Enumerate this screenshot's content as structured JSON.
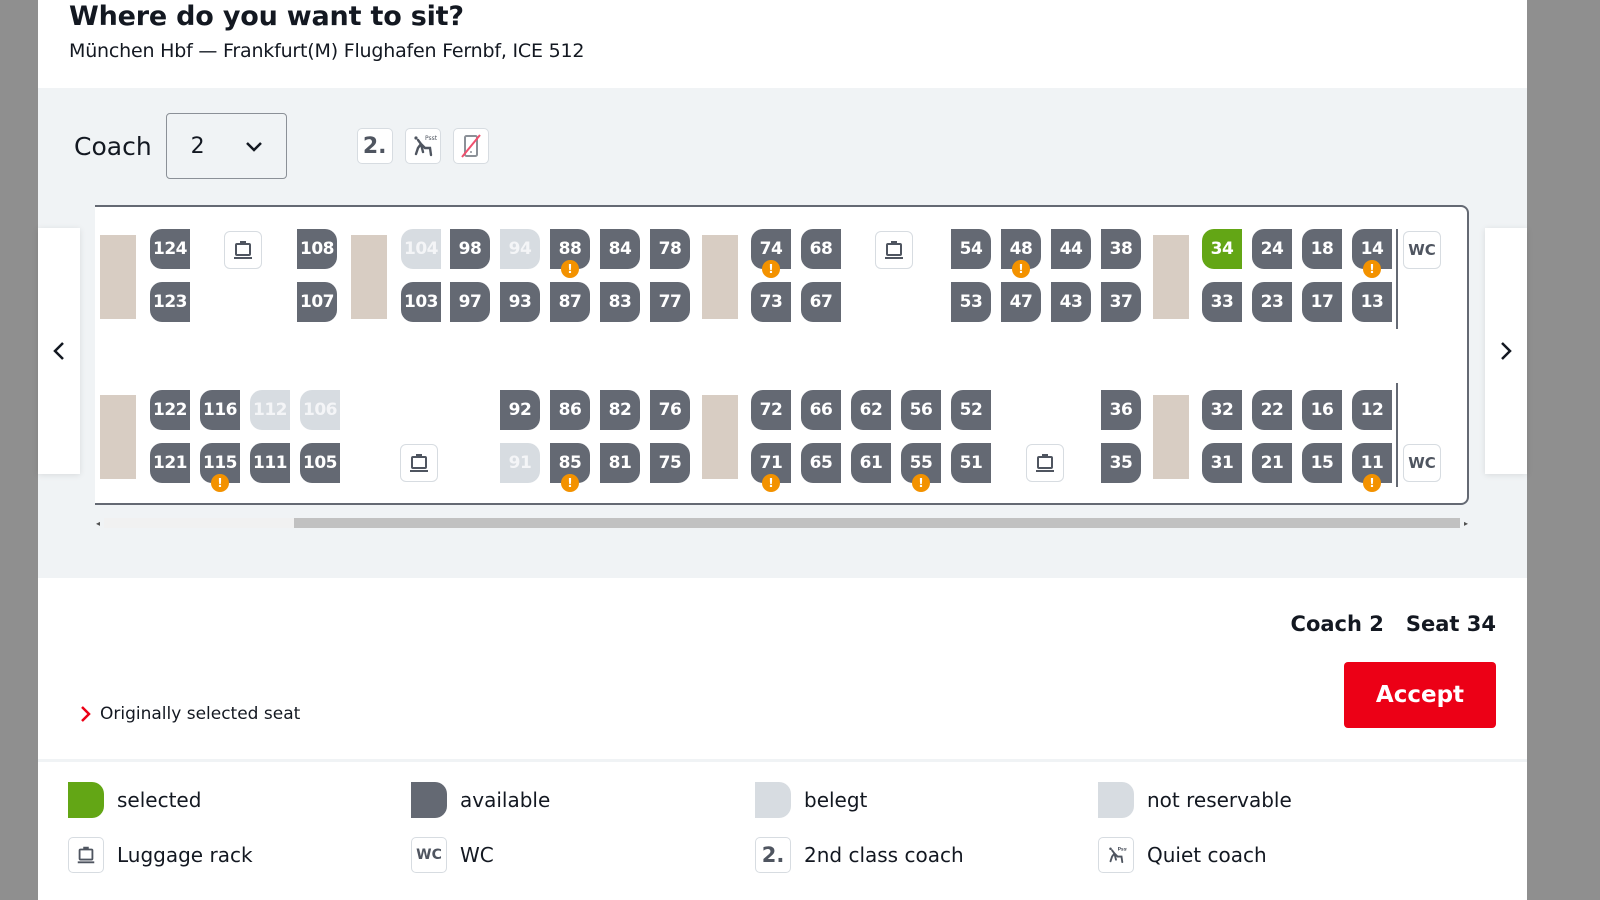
{
  "header": {
    "title": "Where do you want to sit?",
    "route": "München Hbf — Frankfurt(M) Flughafen Fernbf, ICE 512"
  },
  "coach_selector": {
    "label": "Coach",
    "selected": "2",
    "icons": [
      {
        "name": "second-class-icon",
        "text": "2."
      },
      {
        "name": "quiet-coach-icon",
        "text": ""
      },
      {
        "name": "no-phone-icon",
        "text": ""
      }
    ]
  },
  "colors": {
    "selected": "#63a615",
    "available": "#646973",
    "occupied": "#d7dce1",
    "table": "#d8cdc3",
    "warning": "#f39200",
    "accept": "#ec0016"
  },
  "seats": [
    {
      "n": "124",
      "state": "available",
      "face": "l",
      "warn": false
    },
    {
      "n": "123",
      "state": "available",
      "face": "l",
      "warn": false
    },
    {
      "n": "108",
      "state": "available",
      "face": "r",
      "warn": false
    },
    {
      "n": "107",
      "state": "available",
      "face": "r",
      "warn": false
    },
    {
      "n": "104",
      "state": "occupied",
      "face": "l",
      "warn": false
    },
    {
      "n": "103",
      "state": "available",
      "face": "l",
      "warn": false
    },
    {
      "n": "98",
      "state": "available",
      "face": "r",
      "warn": false
    },
    {
      "n": "97",
      "state": "available",
      "face": "r",
      "warn": false
    },
    {
      "n": "94",
      "state": "occupied",
      "face": "r",
      "warn": false
    },
    {
      "n": "93",
      "state": "available",
      "face": "r",
      "warn": false
    },
    {
      "n": "88",
      "state": "available",
      "face": "r",
      "warn": true
    },
    {
      "n": "87",
      "state": "available",
      "face": "r",
      "warn": false
    },
    {
      "n": "84",
      "state": "available",
      "face": "r",
      "warn": false
    },
    {
      "n": "83",
      "state": "available",
      "face": "r",
      "warn": false
    },
    {
      "n": "78",
      "state": "available",
      "face": "r",
      "warn": false
    },
    {
      "n": "77",
      "state": "available",
      "face": "r",
      "warn": false
    },
    {
      "n": "74",
      "state": "available",
      "face": "l",
      "warn": true
    },
    {
      "n": "73",
      "state": "available",
      "face": "l",
      "warn": false
    },
    {
      "n": "68",
      "state": "available",
      "face": "l",
      "warn": false
    },
    {
      "n": "67",
      "state": "available",
      "face": "l",
      "warn": false
    },
    {
      "n": "54",
      "state": "available",
      "face": "r",
      "warn": false
    },
    {
      "n": "53",
      "state": "available",
      "face": "r",
      "warn": false
    },
    {
      "n": "48",
      "state": "available",
      "face": "r",
      "warn": true
    },
    {
      "n": "47",
      "state": "available",
      "face": "r",
      "warn": false
    },
    {
      "n": "44",
      "state": "available",
      "face": "r",
      "warn": false
    },
    {
      "n": "43",
      "state": "available",
      "face": "r",
      "warn": false
    },
    {
      "n": "38",
      "state": "available",
      "face": "r",
      "warn": false
    },
    {
      "n": "37",
      "state": "available",
      "face": "r",
      "warn": false
    },
    {
      "n": "34",
      "state": "selected",
      "face": "l",
      "warn": false
    },
    {
      "n": "33",
      "state": "available",
      "face": "l",
      "warn": false
    },
    {
      "n": "24",
      "state": "available",
      "face": "l",
      "warn": false
    },
    {
      "n": "23",
      "state": "available",
      "face": "l",
      "warn": false
    },
    {
      "n": "18",
      "state": "available",
      "face": "l",
      "warn": false
    },
    {
      "n": "17",
      "state": "available",
      "face": "l",
      "warn": false
    },
    {
      "n": "14",
      "state": "available",
      "face": "l",
      "warn": true
    },
    {
      "n": "13",
      "state": "available",
      "face": "l",
      "warn": false
    },
    {
      "n": "122",
      "state": "available",
      "face": "l",
      "warn": false
    },
    {
      "n": "121",
      "state": "available",
      "face": "l",
      "warn": false
    },
    {
      "n": "116",
      "state": "available",
      "face": "l",
      "warn": false
    },
    {
      "n": "115",
      "state": "available",
      "face": "l",
      "warn": true
    },
    {
      "n": "112",
      "state": "occupied",
      "face": "l",
      "warn": false
    },
    {
      "n": "111",
      "state": "available",
      "face": "l",
      "warn": false
    },
    {
      "n": "106",
      "state": "occupied",
      "face": "l",
      "warn": false
    },
    {
      "n": "105",
      "state": "available",
      "face": "l",
      "warn": false
    },
    {
      "n": "92",
      "state": "available",
      "face": "r",
      "warn": false
    },
    {
      "n": "91",
      "state": "occupied",
      "face": "r",
      "warn": false
    },
    {
      "n": "86",
      "state": "available",
      "face": "r",
      "warn": false
    },
    {
      "n": "85",
      "state": "available",
      "face": "r",
      "warn": true
    },
    {
      "n": "82",
      "state": "available",
      "face": "r",
      "warn": false
    },
    {
      "n": "81",
      "state": "available",
      "face": "r",
      "warn": false
    },
    {
      "n": "76",
      "state": "available",
      "face": "r",
      "warn": false
    },
    {
      "n": "75",
      "state": "available",
      "face": "r",
      "warn": false
    },
    {
      "n": "72",
      "state": "available",
      "face": "l",
      "warn": false
    },
    {
      "n": "71",
      "state": "available",
      "face": "l",
      "warn": true
    },
    {
      "n": "66",
      "state": "available",
      "face": "l",
      "warn": false
    },
    {
      "n": "65",
      "state": "available",
      "face": "l",
      "warn": false
    },
    {
      "n": "62",
      "state": "available",
      "face": "l",
      "warn": false
    },
    {
      "n": "61",
      "state": "available",
      "face": "l",
      "warn": false
    },
    {
      "n": "56",
      "state": "available",
      "face": "l",
      "warn": false
    },
    {
      "n": "55",
      "state": "available",
      "face": "l",
      "warn": true
    },
    {
      "n": "52",
      "state": "available",
      "face": "l",
      "warn": false
    },
    {
      "n": "51",
      "state": "available",
      "face": "l",
      "warn": false
    },
    {
      "n": "36",
      "state": "available",
      "face": "r",
      "warn": false
    },
    {
      "n": "35",
      "state": "available",
      "face": "r",
      "warn": false
    },
    {
      "n": "32",
      "state": "available",
      "face": "l",
      "warn": false
    },
    {
      "n": "31",
      "state": "available",
      "face": "l",
      "warn": false
    },
    {
      "n": "22",
      "state": "available",
      "face": "l",
      "warn": false
    },
    {
      "n": "21",
      "state": "available",
      "face": "l",
      "warn": false
    },
    {
      "n": "16",
      "state": "available",
      "face": "l",
      "warn": false
    },
    {
      "n": "15",
      "state": "available",
      "face": "l",
      "warn": false
    },
    {
      "n": "12",
      "state": "available",
      "face": "l",
      "warn": false
    },
    {
      "n": "11",
      "state": "available",
      "face": "l",
      "warn": true
    }
  ],
  "facilities": {
    "wc_label": "WC"
  },
  "selection": {
    "coach": "Coach 2",
    "seat": "Seat 34"
  },
  "accept_label": "Accept",
  "original_seat_link": "Originally selected seat",
  "legend": [
    {
      "key": "selected",
      "label": "selected"
    },
    {
      "key": "available",
      "label": "available"
    },
    {
      "key": "occupied",
      "label": "belegt"
    },
    {
      "key": "not-reservable",
      "label": "not reservable"
    },
    {
      "key": "luggage",
      "label": "Luggage rack"
    },
    {
      "key": "wc",
      "label": "WC"
    },
    {
      "key": "second-class",
      "label": "2nd class coach",
      "icon_text": "2."
    },
    {
      "key": "quiet",
      "label": "Quiet coach"
    }
  ]
}
